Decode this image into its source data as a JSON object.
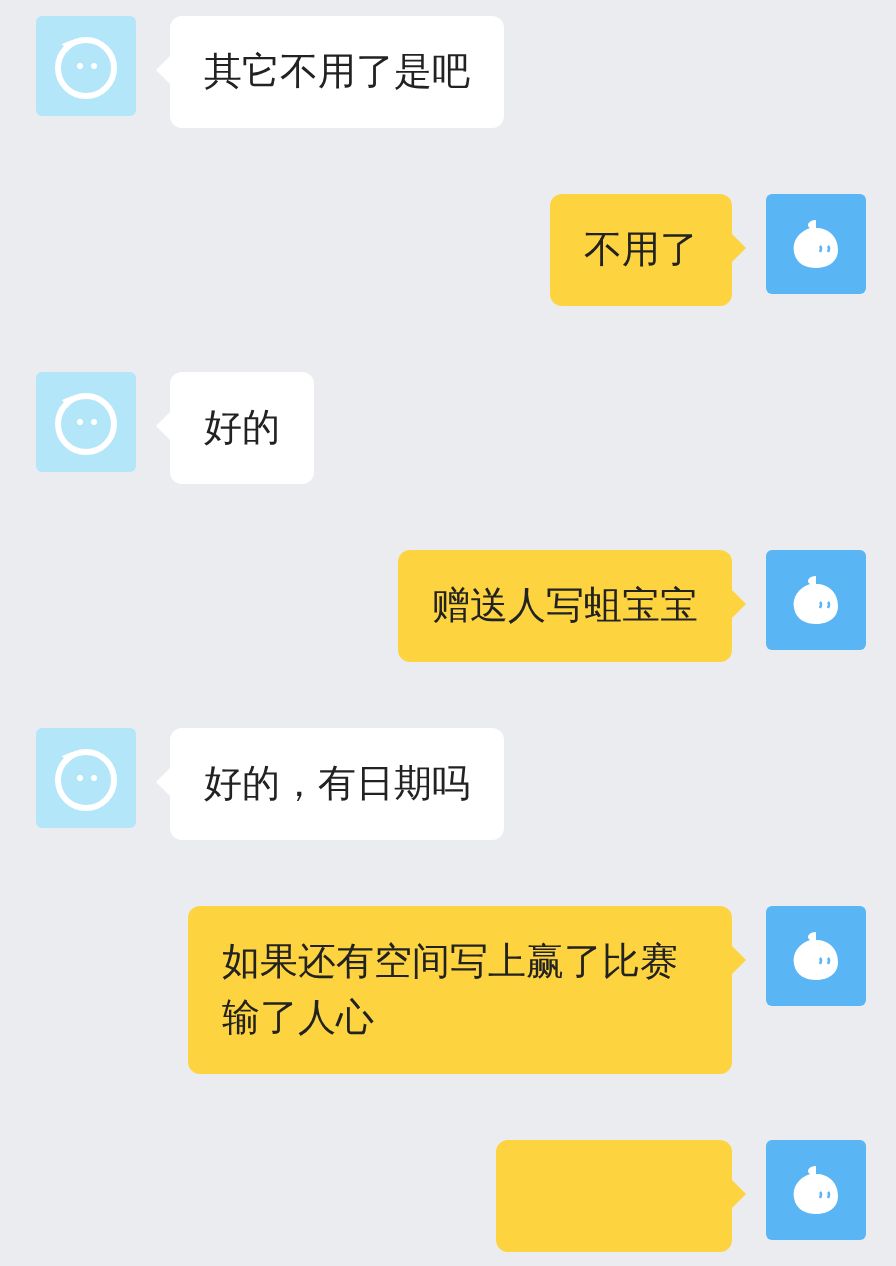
{
  "messages": [
    {
      "kind": "incoming",
      "text": "其它不用了是吧"
    },
    {
      "kind": "outgoing",
      "text": "不用了"
    },
    {
      "kind": "incoming",
      "text": "好的"
    },
    {
      "kind": "outgoing",
      "text": "赠送人写蛆宝宝"
    },
    {
      "kind": "incoming",
      "text": "好的，有日期吗"
    },
    {
      "kind": "outgoing",
      "text": "如果还有空间写上赢了比赛输了人心"
    },
    {
      "kind": "outgoing"
    }
  ]
}
